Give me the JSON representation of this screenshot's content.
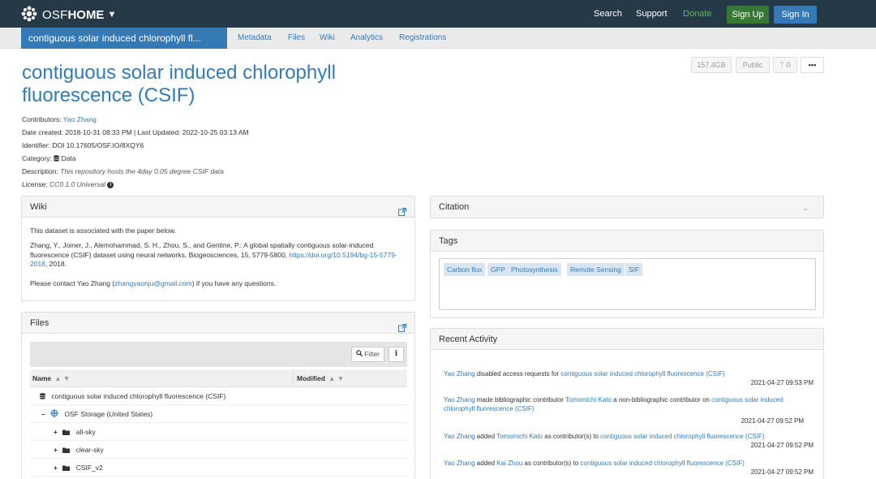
{
  "navbar": {
    "brand_osf": "OSF",
    "brand_home": "HOME",
    "search": "Search",
    "support": "Support",
    "donate": "Donate",
    "sign_up": "Sign Up",
    "sign_in": "Sign In",
    "donate_color": "#5cb85c",
    "bg_color": "#263947"
  },
  "subnav": {
    "project_title": "contiguous solar induced chlorophyll fl...",
    "tabs": [
      "Metadata",
      "Files",
      "Wiki",
      "Analytics",
      "Registrations"
    ]
  },
  "project": {
    "title": "contiguous solar induced chlorophyll fluorescence (CSIF)",
    "size": "157.4GB",
    "visibility": "Public",
    "forks": "0",
    "more": "•••",
    "contributors_label": "Contributors:",
    "contributor": "Yao Zhang",
    "dates": "Date created: 2018-10-31 08:33 PM | Last Updated: 2022-10-25 03:13 AM",
    "identifier": "Identifier: DOI 10.17605/OSF.IO/8XQY6",
    "category_label": "Category:",
    "category": "Data",
    "description_label": "Description:",
    "description": "This repository hosts the 4day 0.05 degree CSIF data",
    "license_label": "License:",
    "license": "CC0 1.0 Universal"
  },
  "wiki": {
    "title": "Wiki",
    "p1": "This dataset is associated with the paper below.",
    "p2a": "Zhang, Y., Joiner, J., Alemohammad, S. H., Zhou, S., and Gentine, P.: A global spatially contiguous solar-induced fluorescence (CSIF) dataset using neural networks, Biogeosciences, 15, 5779-5800,",
    "p2_link": "https://doi.org/10.5194/bg-15-5779-2018",
    "p2b": ", 2018.",
    "p3a": "Please contact Yao Zhang (",
    "p3_link": "zhangyaonju@gmail.com",
    "p3b": ") if you have any questions."
  },
  "files": {
    "title": "Files",
    "filter": "Filter",
    "info": "i",
    "col_name": "Name",
    "col_modified": "Modified",
    "sort_arrows": "▲ ▼",
    "rows": [
      {
        "toggle": "",
        "label": "contiguous solar induced chlorophyll fluorescence (CSIF)"
      },
      {
        "toggle": "–",
        "label": "OSF Storage (United States)"
      },
      {
        "toggle": "+",
        "label": "all-sky"
      },
      {
        "toggle": "+",
        "label": "clear-sky"
      },
      {
        "toggle": "+",
        "label": "CSIF_v2"
      }
    ]
  },
  "citation": {
    "title": "Citation"
  },
  "tags": {
    "title": "Tags",
    "items": [
      "Carbon flux",
      "GPP",
      "Photosynthesis",
      "Remote Sensing",
      "SIF"
    ]
  },
  "activity": {
    "title": "Recent Activity",
    "items": [
      {
        "user": "Yao Zhang",
        "text": " disabled access requests for ",
        "target": "contiguous solar induced chlorophyll fluorescence (CSIF)",
        "date": "2021-04-27 09:53 PM"
      },
      {
        "user": "Yao Zhang",
        "text": " made bibliographic contributor ",
        "target": "Tomomichi Kato",
        "text2": " a non-bibliographic contributor on ",
        "target2": "contiguous solar induced chlorophyll fluorescence (CSIF)",
        "date": "2021-04-27 09:52 PM"
      },
      {
        "user": "Yao Zhang",
        "text": " added ",
        "target": "Tomomichi Kato",
        "text2": " as contributor(s) to ",
        "target2": "contiguous solar induced chlorophyll fluorescence (CSIF)",
        "date": "2021-04-27 09:52 PM"
      },
      {
        "user": "Yao Zhang",
        "text": " added ",
        "target": "Kai Zhou",
        "text2": " as contributor(s) to ",
        "target2": "contiguous solar induced chlorophyll fluorescence (CSIF)",
        "date": "2021-04-27 09:52 PM"
      }
    ]
  },
  "icons": {
    "logo": "osf-logo-icon",
    "caret": "caret-down-icon",
    "external": "external-link-icon",
    "filter": "search-icon",
    "database": "database-icon",
    "storage": "osf-storage-icon",
    "folder": "folder-icon",
    "fork": "fork-icon",
    "info": "info-circle-icon"
  }
}
